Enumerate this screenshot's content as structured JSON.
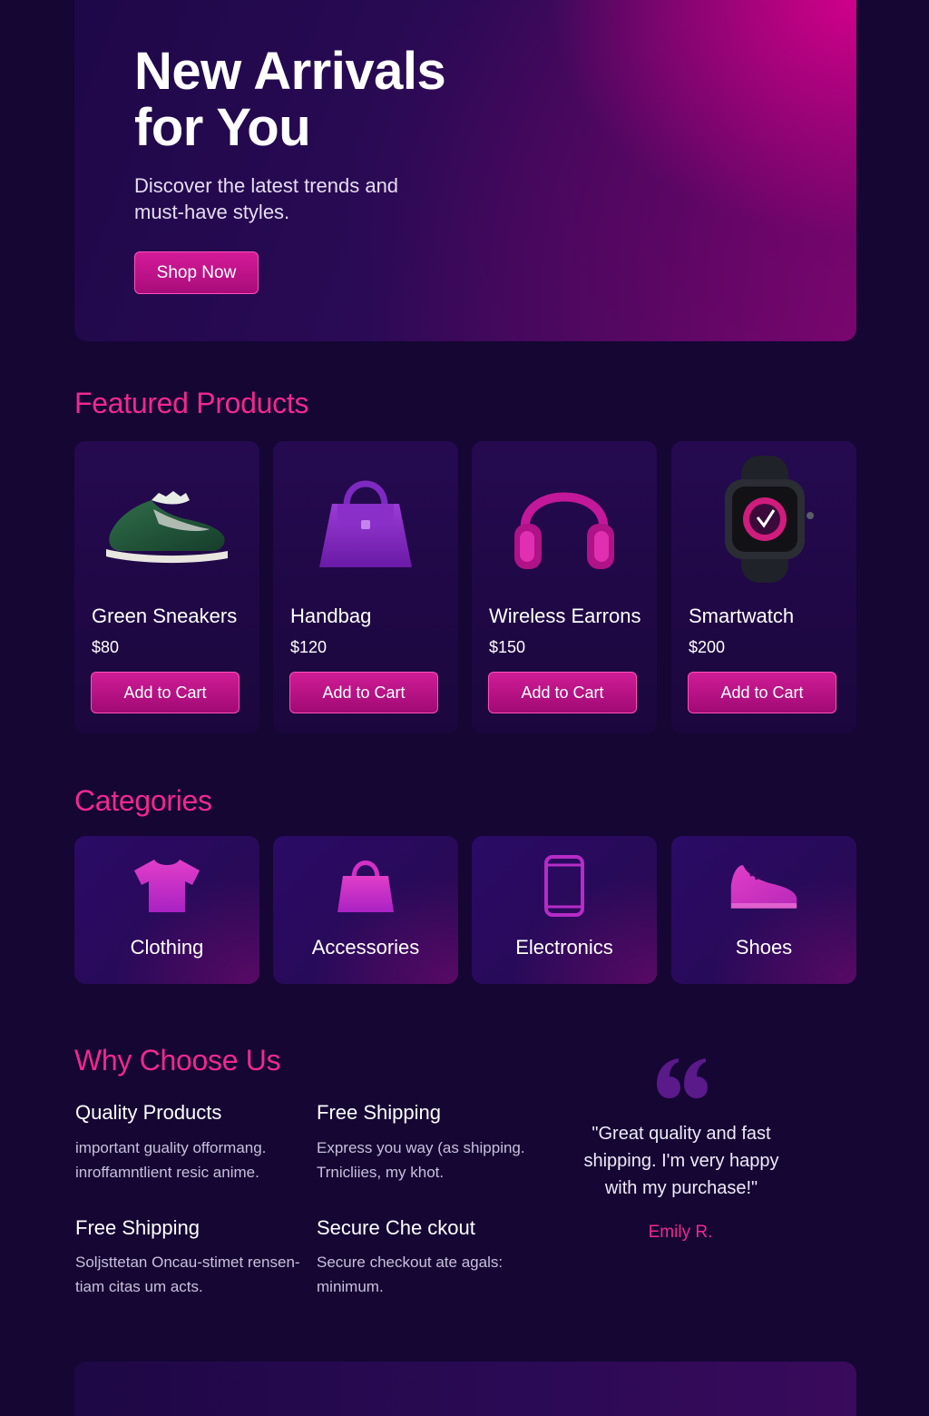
{
  "hero": {
    "title": "New Arrivals for You",
    "subtitle": "Discover the latest trends and must-have styles.",
    "cta_label": "Shop Now"
  },
  "featured": {
    "heading": "Featured Products",
    "add_label": "Add to Cart",
    "products": [
      {
        "name": "Green Sneakers",
        "price": "$80",
        "icon": "sneaker-icon"
      },
      {
        "name": "Handbag",
        "price": "$120",
        "icon": "handbag-icon"
      },
      {
        "name": "Wireless Earrons",
        "price": "$150",
        "icon": "headphones-icon"
      },
      {
        "name": "Smartwatch",
        "price": "$200",
        "icon": "smartwatch-icon"
      }
    ]
  },
  "categories": {
    "heading": "Categories",
    "items": [
      {
        "label": "Clothing",
        "icon": "tshirt-icon"
      },
      {
        "label": "Accessories",
        "icon": "bag-icon"
      },
      {
        "label": "Electronics",
        "icon": "phone-icon"
      },
      {
        "label": "Shoes",
        "icon": "shoe-icon"
      }
    ]
  },
  "why": {
    "heading": "Why Choose Us",
    "features": [
      {
        "title": "Quality Products",
        "desc": "important guality offormang. inroffamntlient resic anime."
      },
      {
        "title": "Free Shipping",
        "desc": "Express you way (as shipping. Trnicliies, my khot."
      },
      {
        "title": "Free Shipping",
        "desc": "Soljsttetan Oncau-stimet rensen-tiam citas um acts."
      },
      {
        "title": "Secure Che ckout",
        "desc": "Secure checkout ate agals: minimum."
      }
    ]
  },
  "testimonial": {
    "quote": "\"Great quality and fast shipping. I'm very happy with my purchase!\"",
    "author": "Emily R."
  },
  "colors": {
    "background": "#150634",
    "accent": "#f0288f",
    "button": "#c0148a"
  }
}
